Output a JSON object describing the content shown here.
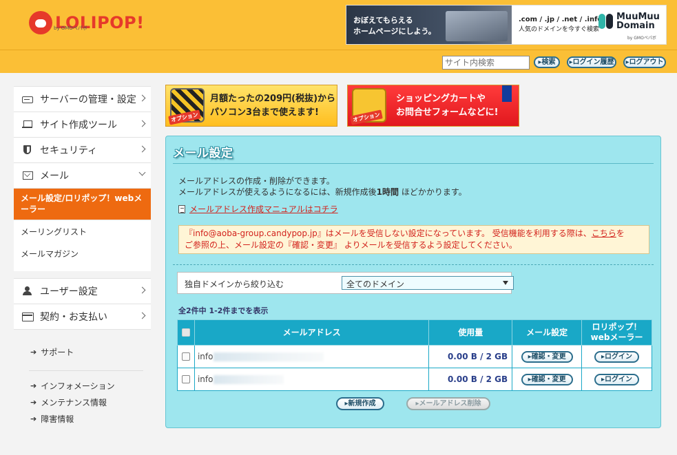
{
  "header": {
    "logo_text": "LOLIPOP!",
    "logo_sub": "by GMOペパボ",
    "banner": {
      "left_text": "おぼえてもらえる\nホームページにしよう。",
      "mid_text": ".com / .jp / .net / .info",
      "mid_sub": "人気のドメインを今すぐ検索",
      "brand_line1": "MuuMuu",
      "brand_line2": "Domain",
      "brand_sub": "by GMOペパボ"
    },
    "search_placeholder": "サイト内検索",
    "search_button": "▸検索",
    "login_history_button": "▸ログイン履歴",
    "logout_button": "▸ログアウト"
  },
  "sidebar": {
    "group1": [
      {
        "label": "サーバーの管理・設定",
        "icon": "server-icon"
      },
      {
        "label": "サイト作成ツール",
        "icon": "laptop-icon"
      },
      {
        "label": "セキュリティ",
        "icon": "shield-icon"
      },
      {
        "label": "メール",
        "icon": "mail-icon"
      }
    ],
    "mail_sub": {
      "active": "メール設定/ロリポップ！webメーラー",
      "items": [
        "メーリングリスト",
        "メールマガジン"
      ]
    },
    "group2": [
      {
        "label": "ユーザー設定",
        "icon": "user-icon"
      },
      {
        "label": "契約・お支払い",
        "icon": "card-icon"
      }
    ],
    "links": {
      "support": "サポート",
      "info": "インフォメーション",
      "maintenance": "メンテナンス情報",
      "failure": "障害情報"
    }
  },
  "promos": {
    "promo1": {
      "option": "オプション",
      "text": "月額たったの209円(税抜)から\nパソコン3台まで使えます!"
    },
    "promo2": {
      "option": "オプション",
      "text": "ショッピングカートや\nお問合せフォームなどに!"
    }
  },
  "panel": {
    "title": "メール設定",
    "desc_line1": "メールアドレスの作成・削除ができます。",
    "desc_line2_pre": "メールアドレスが使えるようになるには、新規作成後",
    "desc_line2_bold": "1時間",
    "desc_line2_post": "ほどかかります。",
    "manual_link": "メールアドレス作成マニュアルはコチラ",
    "alert_pre": "『info@aoba-group.candypop.jp』はメールを受信しない設定になっています。 受信機能を利用する際は、",
    "alert_link": "こちら",
    "alert_post": "を",
    "alert_line2": "ご参照の上、メール設定の『確認・変更』 よりメールを受信するよう設定してください。",
    "filter_label": "独自ドメインから絞り込む",
    "filter_value": "全てのドメイン",
    "count_text": "全2件中 1-2件までを表示",
    "table": {
      "headers": [
        "メールアドレス",
        "使用量",
        "メール設定",
        "ロリポップ！\nwebメーラー"
      ],
      "rows": [
        {
          "address": "info",
          "usage": "0.00 B / 2 GB",
          "settings_button": "▸確認・変更",
          "login_button": "▸ログイン"
        },
        {
          "address": "info",
          "usage": "0.00 B / 2 GB",
          "settings_button": "▸確認・変更",
          "login_button": "▸ログイン"
        }
      ]
    },
    "new_button": "▸新規作成",
    "delete_button": "▸メールアドレス削除"
  },
  "colors": {
    "header_bg": "#fbbf36",
    "active_nav": "#ee6a10",
    "panel_bg": "#9ee6ee",
    "table_header": "#19a8c7",
    "alert_text": "#d2221c"
  }
}
